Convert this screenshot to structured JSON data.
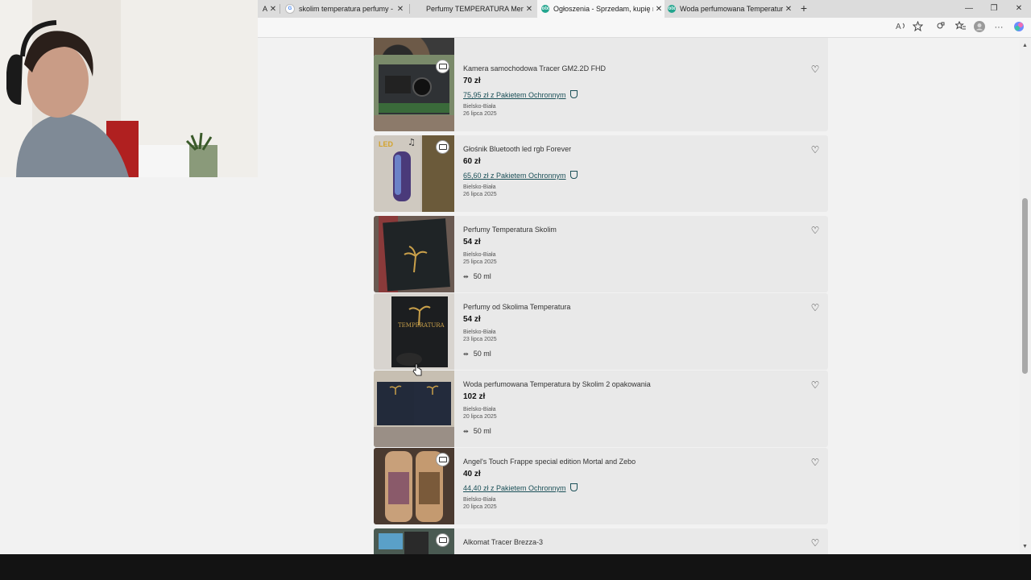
{
  "browser": {
    "tabs": [
      {
        "title": "A",
        "favicon": "olx"
      },
      {
        "title": "skolim temperatura perfumy - Sz",
        "favicon": "google"
      },
      {
        "title": "Perfumy TEMPERATURA Men&W",
        "favicon": "generic"
      },
      {
        "title": "Ogłoszenia - Sprzedam, kupię na",
        "favicon": "olx",
        "active": true
      },
      {
        "title": "Woda perfumowana Temperatura",
        "favicon": "olx"
      }
    ],
    "new_tab": "+",
    "window_controls": [
      "—",
      "❐",
      "✕"
    ],
    "toolbar_icons": [
      "read-aloud-icon",
      "favorite-star-icon",
      "extensions-icon",
      "favorites-icon",
      "profile-icon",
      "more-icon",
      "copilot-icon"
    ]
  },
  "listings": [
    {
      "title": "Kamera samochodowa Tracer GM2.2D FHD",
      "price": "70 zł",
      "protection": "75,95 zł z Pakietem Ochronnym",
      "location": "Bielsko-Biała",
      "date": "26 lipca 2025",
      "size": "",
      "delivery": true
    },
    {
      "title": "Głośnik Bluetooth led rgb Forever",
      "price": "60 zł",
      "protection": "65,60 zł z Pakietem Ochronnym",
      "location": "Bielsko-Biała",
      "date": "26 lipca 2025",
      "size": "",
      "delivery": true
    },
    {
      "title": "Perfumy Temperatura Skolim",
      "price": "54 zł",
      "protection": "",
      "location": "Bielsko-Biała",
      "date": "25 lipca 2025",
      "size": "50 ml",
      "delivery": false
    },
    {
      "title": "Perfumy od Skolima Temperatura",
      "price": "54 zł",
      "protection": "",
      "location": "Bielsko-Biała",
      "date": "23 lipca 2025",
      "size": "50 ml",
      "delivery": false
    },
    {
      "title": "Woda perfumowana Temperatura by Skolim 2 opakowania",
      "price": "102 zł",
      "protection": "",
      "location": "Bielsko-Biała",
      "date": "20 lipca 2025",
      "size": "50 ml",
      "delivery": false
    },
    {
      "title": "Angel's Touch Frappe special edition Mortal and Zebo",
      "price": "40 zł",
      "protection": "44,40 zł z Pakietem Ochronnym",
      "location": "Bielsko-Biała",
      "date": "20 lipca 2025",
      "size": "",
      "delivery": true
    },
    {
      "title": "Alkomat Tracer Brezza-3",
      "price": "",
      "protection": "",
      "location": "",
      "date": "",
      "size": "",
      "delivery": true
    }
  ],
  "colors": {
    "page_bg": "#f2f2f2",
    "card_bg": "#e9e9e9",
    "link": "#1a4f57"
  }
}
